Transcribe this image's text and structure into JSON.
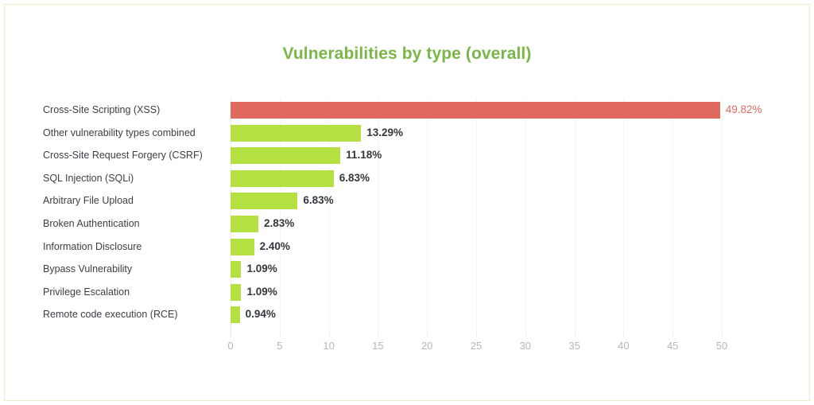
{
  "chart_data": {
    "type": "bar",
    "orientation": "horizontal",
    "title": "Vulnerabilities by type (overall)",
    "xlabel": "",
    "ylabel": "",
    "xlim": [
      0,
      50
    ],
    "xticks": [
      0,
      5,
      10,
      15,
      20,
      25,
      30,
      35,
      40,
      45,
      50
    ],
    "xtick_labels": [
      "0",
      "5",
      "10",
      "15",
      "20",
      "25",
      "30",
      "35",
      "40",
      "45",
      "50"
    ],
    "grid": true,
    "legend": false,
    "categories": [
      "Cross-Site Scripting (XSS)",
      "Other vulnerability types combined",
      "Cross-Site Request Forgery (CSRF)",
      "SQL Injection (SQLi)",
      "Arbitrary File Upload",
      "Broken Authentication",
      "Information Disclosure",
      "Bypass Vulnerability",
      "Privilege Escalation",
      "Remote code execution (RCE)"
    ],
    "values": [
      49.82,
      13.29,
      11.18,
      6.83,
      6.83,
      2.83,
      2.4,
      1.09,
      1.09,
      0.94
    ],
    "drawn_values": [
      49.82,
      13.29,
      11.18,
      10.5,
      6.83,
      2.83,
      2.4,
      1.09,
      1.09,
      0.94
    ],
    "value_labels": [
      "49.82%",
      "13.29%",
      "11.18%",
      "6.83%",
      "6.83%",
      "2.83%",
      "2.40%",
      "1.09%",
      "1.09%",
      "0.94%"
    ],
    "bar_colors": [
      "#e0695f",
      "#b5e042",
      "#b5e042",
      "#b5e042",
      "#b5e042",
      "#b5e042",
      "#b5e042",
      "#b5e042",
      "#b5e042",
      "#b5e042"
    ],
    "highlight_index": 0,
    "colors": {
      "accent_green": "#b5e042",
      "highlight_red": "#e0695f",
      "title_green": "#7ab648",
      "label_text": "#3b3f45",
      "tick_text": "#b6b6b6",
      "gridline": "#f7f6ea",
      "border": "#eaeec4",
      "background": "#ffffff"
    }
  }
}
